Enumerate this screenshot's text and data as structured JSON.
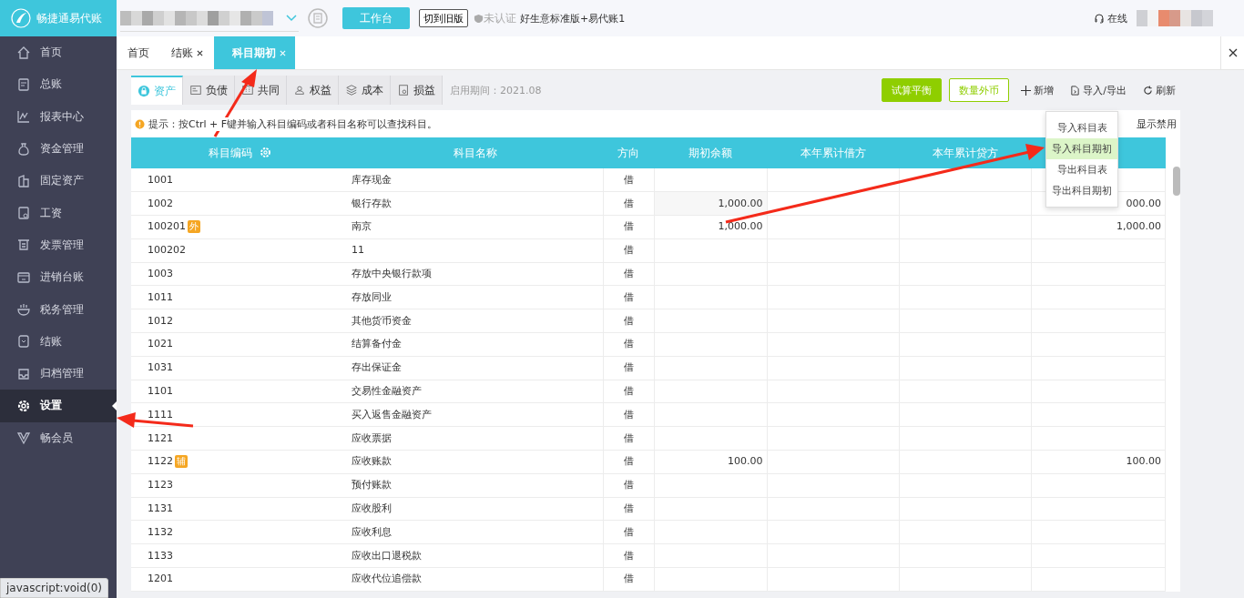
{
  "logo": {
    "text": "畅捷通易代账"
  },
  "top_bar": {
    "workbench_button": "工作台",
    "old_version_button": "切到旧版",
    "certification": "未认证",
    "edition": "好生意标准版+易代账1",
    "online": "在线"
  },
  "sidebar": {
    "items": [
      {
        "label": "首页",
        "selected": false
      },
      {
        "label": "总账",
        "selected": false
      },
      {
        "label": "报表中心",
        "selected": false
      },
      {
        "label": "资金管理",
        "selected": false
      },
      {
        "label": "固定资产",
        "selected": false
      },
      {
        "label": "工资",
        "selected": false
      },
      {
        "label": "发票管理",
        "selected": false
      },
      {
        "label": "进销台账",
        "selected": false
      },
      {
        "label": "税务管理",
        "selected": false
      },
      {
        "label": "结账",
        "selected": false
      },
      {
        "label": "归档管理",
        "selected": false
      },
      {
        "label": "设置",
        "selected": true
      },
      {
        "label": "畅会员",
        "selected": false
      }
    ]
  },
  "page_tabs": [
    {
      "label": "首页",
      "closable": false,
      "selected": false
    },
    {
      "label": "结账",
      "closable": true,
      "selected": false
    },
    {
      "label": "科目期初",
      "closable": true,
      "selected": true
    }
  ],
  "category_tabs": [
    {
      "label": "资产",
      "selected": true
    },
    {
      "label": "负债",
      "selected": false
    },
    {
      "label": "共同",
      "selected": false
    },
    {
      "label": "权益",
      "selected": false
    },
    {
      "label": "成本",
      "selected": false
    },
    {
      "label": "损益",
      "selected": false
    }
  ],
  "period": "启用期间：2021.08",
  "toolbar": [
    {
      "label": "试算平衡",
      "kind": "primary"
    },
    {
      "label": "数量外币",
      "kind": "outline"
    },
    {
      "label": "新增",
      "kind": "add"
    },
    {
      "label": "导入/导出",
      "kind": "import"
    },
    {
      "label": "刷新",
      "kind": "refresh"
    }
  ],
  "hint": "提示：按Ctrl + F键并输入科目编码或者科目名称可以查找科目。",
  "show_disabled": "显示禁用",
  "dropdown": {
    "items": [
      {
        "label": "导入科目表",
        "selected": false
      },
      {
        "label": "导入科目期初",
        "selected": true
      },
      {
        "label": "导出科目表",
        "selected": false
      },
      {
        "label": "导出科目期初",
        "selected": false
      }
    ]
  },
  "table": {
    "columns": [
      "科目编码",
      "科目名称",
      "方向",
      "期初余额",
      "本年累计借方",
      "本年累计贷方"
    ],
    "rows": [
      {
        "code": "1001",
        "name": "库存现金",
        "direction": "借"
      },
      {
        "code": "1002",
        "name": "银行存款",
        "direction": "借",
        "opening": "1,000.00",
        "column_7": "000.00"
      },
      {
        "code": "100201",
        "tag": "外",
        "name": "南京",
        "direction": "借",
        "opening": "1,000.00",
        "column_7": "1,000.00"
      },
      {
        "code": "100202",
        "name": "11",
        "direction": "借"
      },
      {
        "code": "1003",
        "name": "存放中央银行款项",
        "direction": "借"
      },
      {
        "code": "1011",
        "name": "存放同业",
        "direction": "借"
      },
      {
        "code": "1012",
        "name": "其他货币资金",
        "direction": "借"
      },
      {
        "code": "1021",
        "name": "结算备付金",
        "direction": "借"
      },
      {
        "code": "1031",
        "name": "存出保证金",
        "direction": "借"
      },
      {
        "code": "1101",
        "name": "交易性金融资产",
        "direction": "借"
      },
      {
        "code": "1111",
        "name": "买入返售金融资产",
        "direction": "借"
      },
      {
        "code": "1121",
        "name": "应收票据",
        "direction": "借"
      },
      {
        "code": "1122",
        "tag": "辅",
        "name": "应收账款",
        "direction": "借",
        "opening": "100.00",
        "column_7": "100.00"
      },
      {
        "code": "1123",
        "name": "预付账款",
        "direction": "借"
      },
      {
        "code": "1131",
        "name": "应收股利",
        "direction": "借"
      },
      {
        "code": "1132",
        "name": "应收利息",
        "direction": "借"
      },
      {
        "code": "1133",
        "name": "应收出口退税款",
        "direction": "借"
      },
      {
        "code": "1201",
        "name": "应收代位追偿款",
        "direction": "借"
      }
    ]
  },
  "status_tooltip": "javascript:void(0)"
}
